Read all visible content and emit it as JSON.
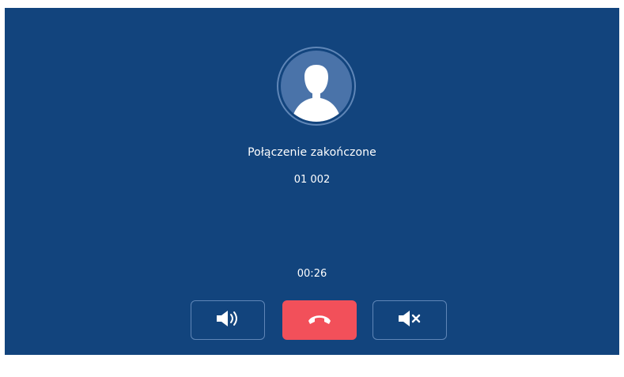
{
  "call": {
    "status": "Połączenie zakończone",
    "number": "01 002",
    "duration": "00:26"
  },
  "avatar": {
    "icon": "user-silhouette-icon"
  },
  "controls": [
    {
      "id": "speaker",
      "icon": "speaker-icon"
    },
    {
      "id": "hangup",
      "icon": "phone-hangup-icon",
      "color": "#f2505a"
    },
    {
      "id": "mute",
      "icon": "speaker-muted-icon"
    }
  ],
  "colors": {
    "background": "#12447d",
    "accent_border": "#5f86b7",
    "avatar_fill": "#4a73a9",
    "hangup": "#f2505a"
  }
}
